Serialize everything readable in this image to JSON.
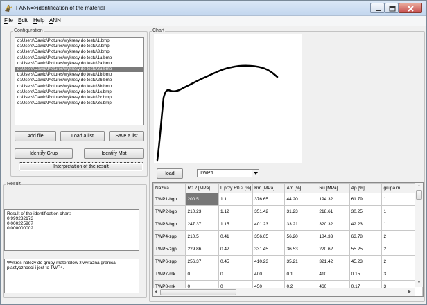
{
  "window": {
    "title": "FANN=>identification of the material"
  },
  "menu": [
    "File",
    "Edit",
    "Help",
    "ANN"
  ],
  "configuration": {
    "label": "Configuration",
    "files": [
      "d:\\Users\\Dawid\\Pictures\\wykresy do testu\\1.bmp",
      "d:\\Users\\Dawid\\Pictures\\wykresy do testu\\2.bmp",
      "d:\\Users\\Dawid\\Pictures\\wykresy do testu\\3.bmp",
      "d:\\Users\\Dawid\\Pictures\\wykresy do testu\\1a.bmp",
      "d:\\Users\\Dawid\\Pictures\\wykresy do testu\\2a.bmp",
      "d:\\Users\\Dawid\\Pictures\\wykresy do testu\\3a.bmp",
      "d:\\Users\\Dawid\\Pictures\\wykresy do testu\\1b.bmp",
      "d:\\Users\\Dawid\\Pictures\\wykresy do testu\\2b.bmp",
      "d:\\Users\\Dawid\\Pictures\\wykresy do testu\\3b.bmp",
      "d:\\Users\\Dawid\\Pictures\\wykresy do testu\\1c.bmp",
      "d:\\Users\\Dawid\\Pictures\\wykresy do testu\\2c.bmp",
      "d:\\Users\\Dawid\\Pictures\\wykresy do testu\\3c.bmp"
    ],
    "selected_index": 5,
    "buttons": {
      "add_file": "Add file",
      "load_list": "Load a list",
      "save_list": "Save a list",
      "identify_grup": "Identify Grup",
      "identify_mat": "Identify Mat",
      "interpretation": "Interpretation of the result"
    }
  },
  "result": {
    "label": "Result",
    "chart_result": "Result of the identification chart:\n0.999232173\n0.000225967\n0.000000002",
    "interpretation_text": "Wykres nalezy do grupy materialow z wyrazna granica plastycznosci i jest to TWP4."
  },
  "chart": {
    "label": "Chart",
    "load_button": "load",
    "combo_value": "TWP4",
    "columns": [
      "Nazwa",
      "R0.2 [MPa]",
      "L przy R0.2 [%]",
      "Rm [MPa]",
      "Am [%]",
      "Ru [MPa]",
      "Ap  [%]",
      "grupa m"
    ],
    "rows": [
      [
        "TWP1-bgp",
        "200.5",
        "1.1",
        "376.65",
        "44.20",
        "194.32",
        "61.79",
        "1"
      ],
      [
        "TWP2-bgp",
        "210.23",
        "1.12",
        "351.42",
        "31.23",
        "218.61",
        "30.25",
        "1"
      ],
      [
        "TWP3-bgp",
        "247.37",
        "1.15",
        "401.23",
        "33.21",
        "320.32",
        "42.23",
        "1"
      ],
      [
        "TWP4-zgp",
        "210.5",
        "0.41",
        "356.65",
        "56.20",
        "184.33",
        "63.78",
        "2"
      ],
      [
        "TWP5-zgp",
        "229.86",
        "0.42",
        "331.45",
        "36.53",
        "220.62",
        "55.25",
        "2"
      ],
      [
        "TWP6-zgp",
        "256.37",
        "0.45",
        "410.23",
        "35.21",
        "321.42",
        "45.23",
        "2"
      ],
      [
        "TWP7-mk",
        "0",
        "0",
        "400",
        "0.1",
        "410",
        "0.15",
        "3"
      ],
      [
        "TWP8-mk",
        "0",
        "0",
        "450",
        "0.2",
        "460",
        "0.17",
        "3"
      ],
      [
        "TWP9-mk",
        "0",
        "0",
        "470",
        "0.4",
        "472",
        "0.18",
        "3"
      ]
    ],
    "selected_cell": [
      0,
      1
    ]
  },
  "colors": {
    "selection": "#7a7a7a",
    "curve": "#000000"
  }
}
